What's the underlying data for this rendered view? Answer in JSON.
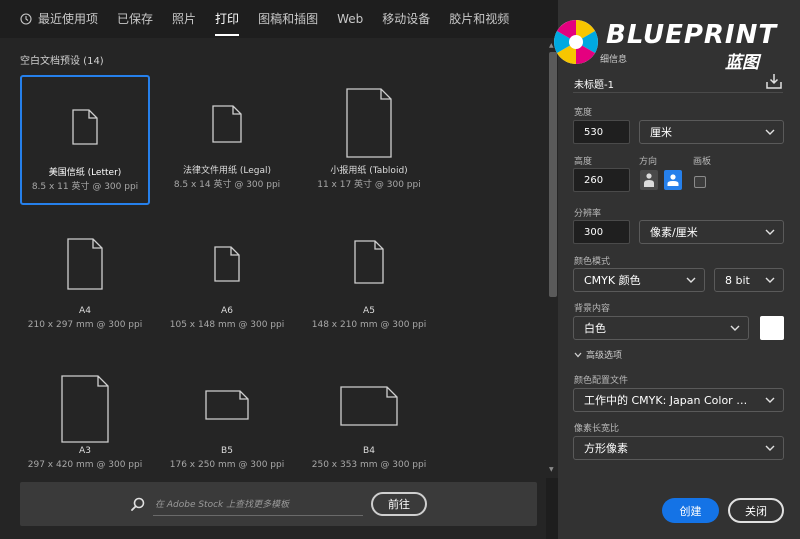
{
  "tabs": [
    {
      "label": "最近使用项",
      "active": false
    },
    {
      "label": "已保存",
      "active": false
    },
    {
      "label": "照片",
      "active": false
    },
    {
      "label": "打印",
      "active": true
    },
    {
      "label": "图稿和插图",
      "active": false
    },
    {
      "label": "Web",
      "active": false
    },
    {
      "label": "移动设备",
      "active": false
    },
    {
      "label": "胶片和视频",
      "active": false
    }
  ],
  "section_title": "空白文档预设 (14)",
  "presets": [
    {
      "name": "美国信纸 (Letter)",
      "desc": "8.5 x 11 英寸 @ 300 ppi",
      "selected": true
    },
    {
      "name": "法律文件用纸 (Legal)",
      "desc": "8.5 x 14 英寸 @ 300 ppi",
      "selected": false
    },
    {
      "name": "小报用纸 (Tabloid)",
      "desc": "11 x 17 英寸 @ 300 ppi",
      "selected": false
    },
    {
      "name": "A4",
      "desc": "210 x 297 mm @ 300 ppi",
      "selected": false
    },
    {
      "name": "A6",
      "desc": "105 x 148 mm @ 300 ppi",
      "selected": false
    },
    {
      "name": "A5",
      "desc": "148 x 210 mm @ 300 ppi",
      "selected": false
    },
    {
      "name": "A3",
      "desc": "297 x 420 mm @ 300 ppi",
      "selected": false
    },
    {
      "name": "B5",
      "desc": "176 x 250 mm @ 300 ppi",
      "selected": false
    },
    {
      "name": "B4",
      "desc": "250 x 353 mm @ 300 ppi",
      "selected": false
    }
  ],
  "search": {
    "placeholder": "在 Adobe Stock 上查找更多模板",
    "go_label": "前往"
  },
  "logo": {
    "text": "BLUEPRINT",
    "sub": "蓝图"
  },
  "details": {
    "title_partial": "细信息",
    "doc_name": "未标题-1",
    "width_label": "宽度",
    "width_value": "530",
    "width_unit": "厘米",
    "height_label": "高度",
    "height_value": "260",
    "orientation_label": "方向",
    "artboard_label": "画板",
    "resolution_label": "分辨率",
    "resolution_value": "300",
    "resolution_unit": "像素/厘米",
    "color_mode_label": "颜色模式",
    "color_mode_value": "CMYK 颜色",
    "bit_depth_value": "8 bit",
    "background_label": "背景内容",
    "background_value": "白色",
    "background_color": "#ffffff",
    "advanced_label": "高级选项",
    "color_profile_label": "颜色配置文件",
    "color_profile_value": "工作中的 CMYK: Japan Color 2001...",
    "pixel_aspect_label": "像素长宽比",
    "pixel_aspect_value": "方形像素",
    "create_label": "创建",
    "close_label": "关闭"
  },
  "colors": {
    "accent": "#1473e6",
    "selected_border": "#2680eb",
    "panel": "#323232",
    "main": "#252525"
  }
}
